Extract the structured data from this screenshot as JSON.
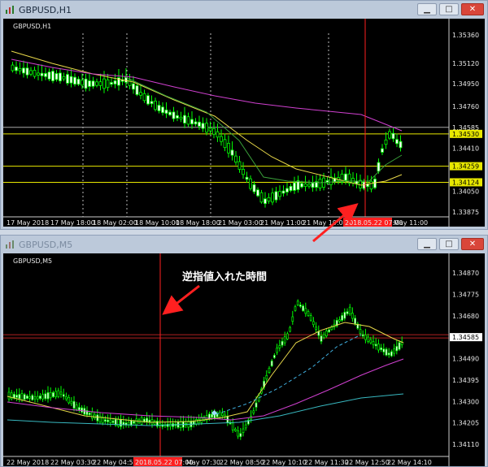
{
  "windows": [
    {
      "title": "GBPUSD,H1",
      "chart_label": "GBPUSD,H1",
      "price_labels": [
        "1.35360",
        "1.35120",
        "1.34950",
        "1.34760",
        "1.34585",
        "1.34530",
        "1.34410",
        "1.34259",
        "1.34124",
        "1.34050",
        "1.33875"
      ],
      "time_labels": [
        "17 May 2018",
        "17 May 18:00",
        "18 May 02:00",
        "18 May 10:00",
        "18 May 18:00",
        "21 May 03:00",
        "21 May 11:00",
        "21 May 19:00",
        "2018.05.22 07:00",
        "May 11:00"
      ],
      "hlines": [
        {
          "price": "1.34585",
          "highlight": false
        },
        {
          "price": "1.34530",
          "highlight": true
        },
        {
          "price": "1.34259",
          "highlight": true
        },
        {
          "price": "1.34124",
          "highlight": true
        }
      ],
      "active": true
    },
    {
      "title": "GBPUSD,M5",
      "chart_label": "GBPUSD,M5",
      "price_labels": [
        "1.34870",
        "1.34775",
        "1.34680",
        "1.34585",
        "1.34490",
        "1.34395",
        "1.34300",
        "1.34205",
        "1.34110"
      ],
      "time_labels": [
        "22 May 2018",
        "22 May 03:30",
        "22 May 04:50",
        "2018.05.22 07:00",
        "May 07:30",
        "22 May 08:50",
        "22 May 10:10",
        "22 May 11:30",
        "22 May 12:50",
        "22 May 14:10"
      ],
      "current_price": "1.34585",
      "active": false
    }
  ],
  "annotation": "逆指値入れた時間",
  "colors": {
    "background": "#000000",
    "bull": "#00ff00",
    "ma_yellow": "#e8d84a",
    "ma_magenta": "#d040d0",
    "ma_cyan": "#40c8d0",
    "ma_green": "#3aa03a",
    "hline": "#e8e800",
    "marker": "#ff2020",
    "arrow": "#ff2020"
  },
  "window_buttons": {
    "minimize": "▁",
    "maximize": "□",
    "close": "✕"
  }
}
